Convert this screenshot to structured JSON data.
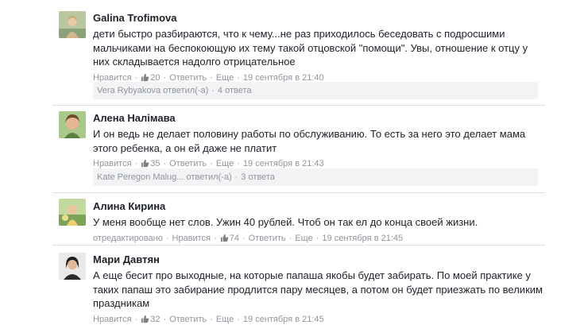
{
  "labels": {
    "like": "Нравится",
    "reply": "Ответить",
    "more": "Еще",
    "sep": "·",
    "edited": "отредактировано"
  },
  "comments": [
    {
      "author": "Galina Trofimova",
      "text": "дети быстро разбираются, что к чему...не раз приходилось беседовать с подросшими мальчиками на беспокоющую их тему такой отцовской \"помощи\". Увы, отношение к отцу у них складывается надолго отрицательное",
      "likes": "20",
      "time": "19 сентября в 21:40",
      "replies_by": "Vera Rybyakova ответил(-а)",
      "replies_count": "4 ответа"
    },
    {
      "author": "Алена Налімава",
      "text": "И он ведь не делает половину работы по обслуживанию. То есть за него это делает мама этого ребенка, а он ей даже не платит",
      "likes": "35",
      "time": "19 сентября в 21:43",
      "replies_by": "Kate Peregon Malug... ответил(-а)",
      "replies_count": "3 ответа"
    },
    {
      "author": "Алина Кирина",
      "text": "У меня вообще нет слов. Ужин 40 рублей. Чтоб он так ел до конца своей жизни.",
      "likes": "74",
      "time": "19 сентября в 21:45"
    },
    {
      "author": "Мари Давтян",
      "text": "А еще бесит про выходные, на которые папаша якобы будет забирать. По моей практике у таких папаш это забирание продлится пару месяцев, а потом он будет приезжать по великим праздникам",
      "likes": "32",
      "time": "19 сентября в 21:45"
    }
  ]
}
